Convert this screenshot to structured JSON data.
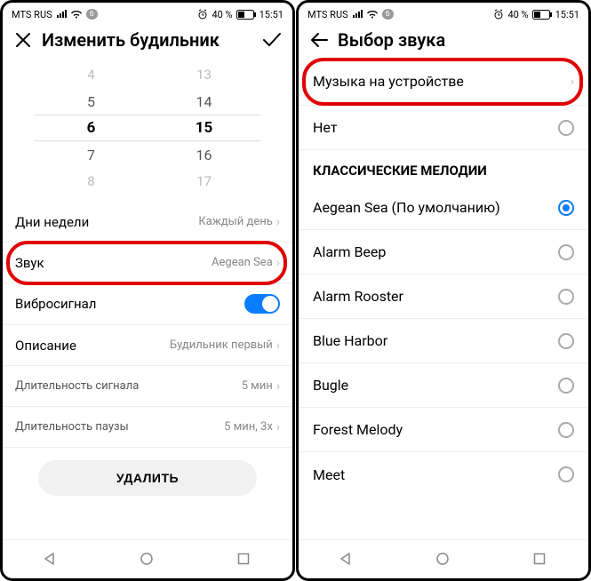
{
  "status": {
    "carrier": "MTS RUS",
    "badge": "6",
    "battery": "40 %",
    "time": "15:51"
  },
  "left": {
    "title": "Изменить будильник",
    "picker": {
      "hours": [
        "4",
        "5",
        "6",
        "7",
        "8"
      ],
      "minutes": [
        "13",
        "14",
        "15",
        "16",
        "17"
      ]
    },
    "rows": {
      "days_label": "Дни недели",
      "days_value": "Каждый день",
      "sound_label": "Звук",
      "sound_value": "Aegean Sea",
      "vibro_label": "Вибросигнал",
      "desc_label": "Описание",
      "desc_value": "Будильник первый",
      "signal_len_label": "Длительность сигнала",
      "signal_len_value": "5 мин",
      "pause_len_label": "Длительность паузы",
      "pause_len_value": "5 мин, 3x"
    },
    "delete": "УДАЛИТЬ"
  },
  "right": {
    "title": "Выбор звука",
    "device_music": "Музыка на устройстве",
    "none": "Нет",
    "section": "КЛАССИЧЕСКИЕ МЕЛОДИИ",
    "items": [
      "Aegean Sea (По умолчанию)",
      "Alarm Beep",
      "Alarm Rooster",
      "Blue Harbor",
      "Bugle",
      "Forest Melody",
      "Meet"
    ]
  }
}
